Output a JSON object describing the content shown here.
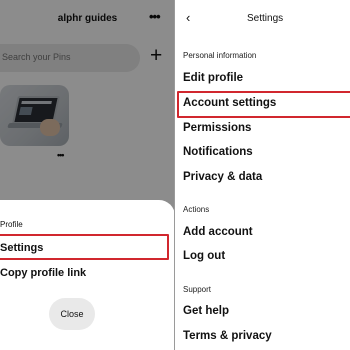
{
  "left": {
    "header": {
      "title": "alphr guides",
      "more_icon": "more-horizontal-icon"
    },
    "search": {
      "placeholder": "Search your Pins"
    },
    "add_icon": "plus-icon",
    "pin": {
      "more_icon": "more-horizontal-icon"
    },
    "sheet": {
      "heading": "Profile",
      "items": [
        "Settings",
        "Copy profile link"
      ],
      "close_label": "Close",
      "highlight_color": "#d1272e"
    }
  },
  "right": {
    "back_icon": "chevron-left-icon",
    "title": "Settings",
    "sections": [
      {
        "heading": "Personal information",
        "items": [
          "Edit profile",
          "Account settings",
          "Permissions",
          "Notifications",
          "Privacy & data"
        ]
      },
      {
        "heading": "Actions",
        "items": [
          "Add account",
          "Log out"
        ]
      },
      {
        "heading": "Support",
        "items": [
          "Get help",
          "Terms & privacy"
        ]
      }
    ],
    "highlighted_item": "Account settings",
    "highlight_color": "#d1272e"
  }
}
